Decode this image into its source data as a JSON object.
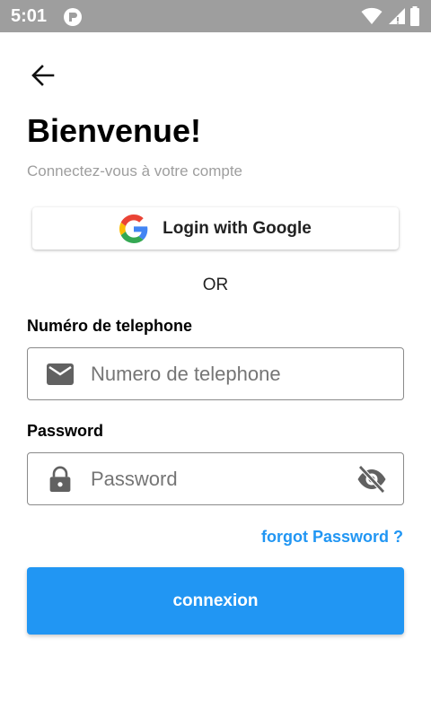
{
  "status_bar": {
    "time": "5:01",
    "background": "#9e9e9e",
    "icons": [
      "app-notification-icon",
      "wifi-icon",
      "signal-icon",
      "battery-icon"
    ]
  },
  "header": {
    "back_icon": "arrow-left-icon",
    "title": "Bienvenue!",
    "subtitle": "Connectez-vous à votre compte"
  },
  "google_login": {
    "label": "Login with Google",
    "icon": "google-logo-icon"
  },
  "divider_text": "OR",
  "phone_field": {
    "label": "Numéro de telephone",
    "placeholder": "Numero de telephone",
    "value": "",
    "icon": "mail-icon"
  },
  "password_field": {
    "label": "Password",
    "placeholder": "Password",
    "value": "",
    "icon": "lock-icon",
    "toggle_icon": "eye-off-icon"
  },
  "forgot_password": "forgot Password ?",
  "submit": {
    "label": "connexion"
  },
  "colors": {
    "primary": "#2196f3",
    "subtitle_text": "#9e9e9e",
    "icon_gray": "#616161",
    "input_border": "#8a8a8a"
  }
}
